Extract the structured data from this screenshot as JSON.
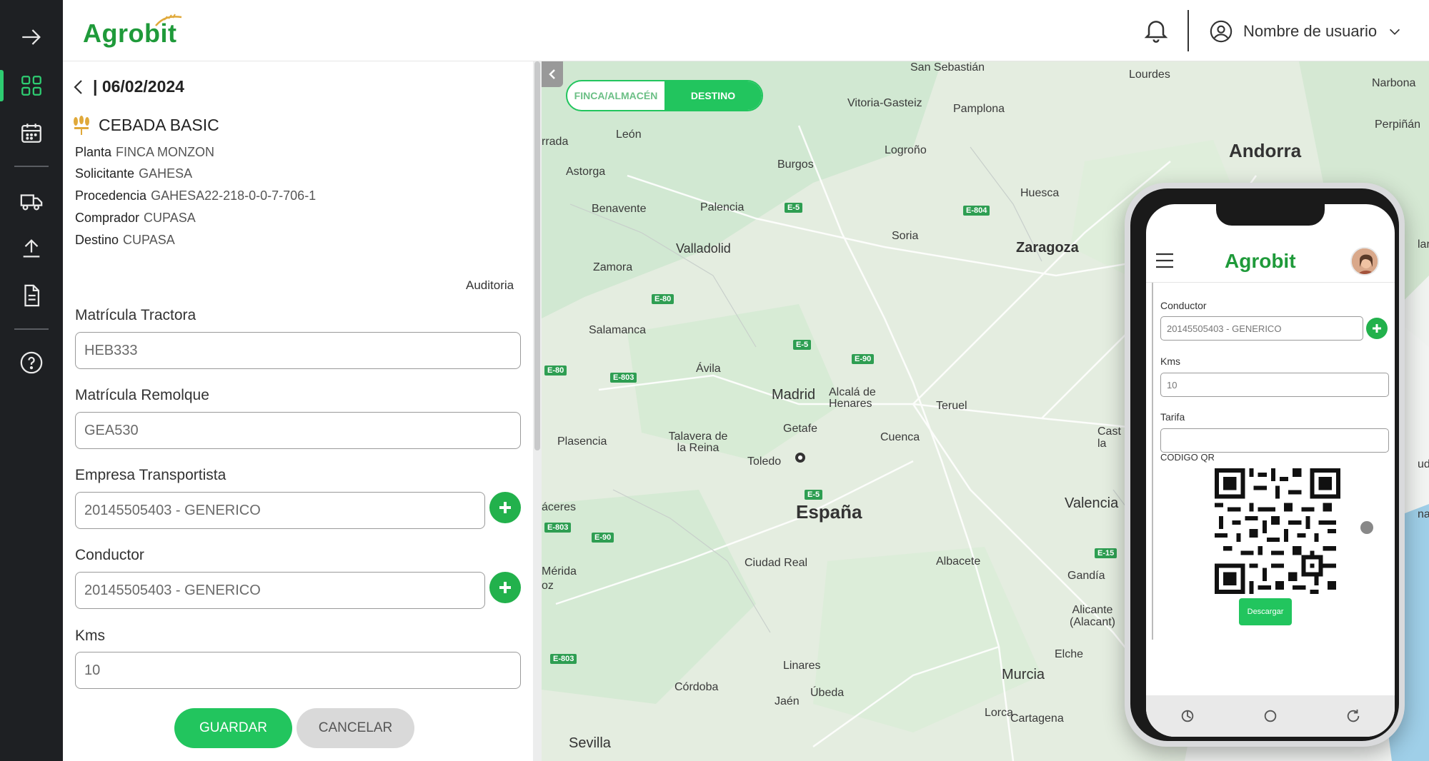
{
  "app": {
    "logo": "Agrobit"
  },
  "header": {
    "user_name": "Nombre de usuario"
  },
  "form": {
    "date": "| 06/02/2024",
    "product": "CEBADA BASIC",
    "fields": [
      {
        "label": "Planta",
        "value": "FINCA MONZON"
      },
      {
        "label": "Solicitante",
        "value": "GAHESA"
      },
      {
        "label": "Procedencia",
        "value": "GAHESA22-218-0-0-7-706-1"
      },
      {
        "label": "Comprador",
        "value": "CUPASA"
      },
      {
        "label": "Destino",
        "value": "CUPASA"
      }
    ],
    "audit_label": "Auditoria",
    "matricula_tractora": {
      "label": "Matrícula Tractora",
      "value": "HEB333"
    },
    "matricula_remolque": {
      "label": "Matrícula Remolque",
      "value": "GEA530"
    },
    "empresa": {
      "label": "Empresa Transportista",
      "value": "20145505403 - GENERICO"
    },
    "conductor": {
      "label": "Conductor",
      "value": "20145505403 - GENERICO"
    },
    "kms": {
      "label": "Kms",
      "value": "10"
    },
    "save_label": "GUARDAR",
    "cancel_label": "CANCELAR"
  },
  "map": {
    "toggle": {
      "left": "FINCA/ALMACÉN",
      "right": "DESTINO",
      "selected": "DESTINO"
    },
    "places": [
      "San Sebastián",
      "Lourdes",
      "Narbona",
      "Vitoria-Gasteiz",
      "Pamplona",
      "León",
      "Perpiñán",
      "Astorga",
      "Burgos",
      "Logroño",
      "Andorra",
      "Benavente",
      "Palencia",
      "Huesca",
      "Valladolid",
      "Soria",
      "Zaragoza",
      "Zamora",
      "Salamanca",
      "Ávila",
      "Madrid",
      "Alcalá de Henares",
      "Getafe",
      "Teruel",
      "Plasencia",
      "Talavera de la Reina",
      "Toledo",
      "Cuenca",
      "España",
      "Valencia",
      "Cáceres",
      "Mérida",
      "Ciudad Real",
      "Albacete",
      "Gandía",
      "Alicante (Alacant)",
      "Elche",
      "Linares",
      "Murcia",
      "Córdoba",
      "Jaén",
      "Úbeda",
      "Lorca",
      "Cartagena",
      "Sevilla",
      "rrada",
      "áceres",
      "oz",
      "Cast de la",
      "lar",
      "udia",
      "nac"
    ],
    "roads": [
      "E-5",
      "E-804",
      "E-80",
      "E-5",
      "E-90",
      "E-80",
      "E-803",
      "E-5",
      "E-803",
      "E-90",
      "E-15",
      "E-803"
    ]
  },
  "phone": {
    "logo": "Agrobit",
    "conductor": {
      "label": "Conductor",
      "value": "20145505403 - GENERICO"
    },
    "kms": {
      "label": "Kms",
      "value": "10"
    },
    "tarifa": {
      "label": "Tarifa",
      "value": ""
    },
    "qr_label": "CODIGO QR",
    "download_label": "Descargar"
  },
  "colors": {
    "accent": "#22c55e",
    "brand": "#1f9a3a",
    "rail": "#1e2023"
  }
}
